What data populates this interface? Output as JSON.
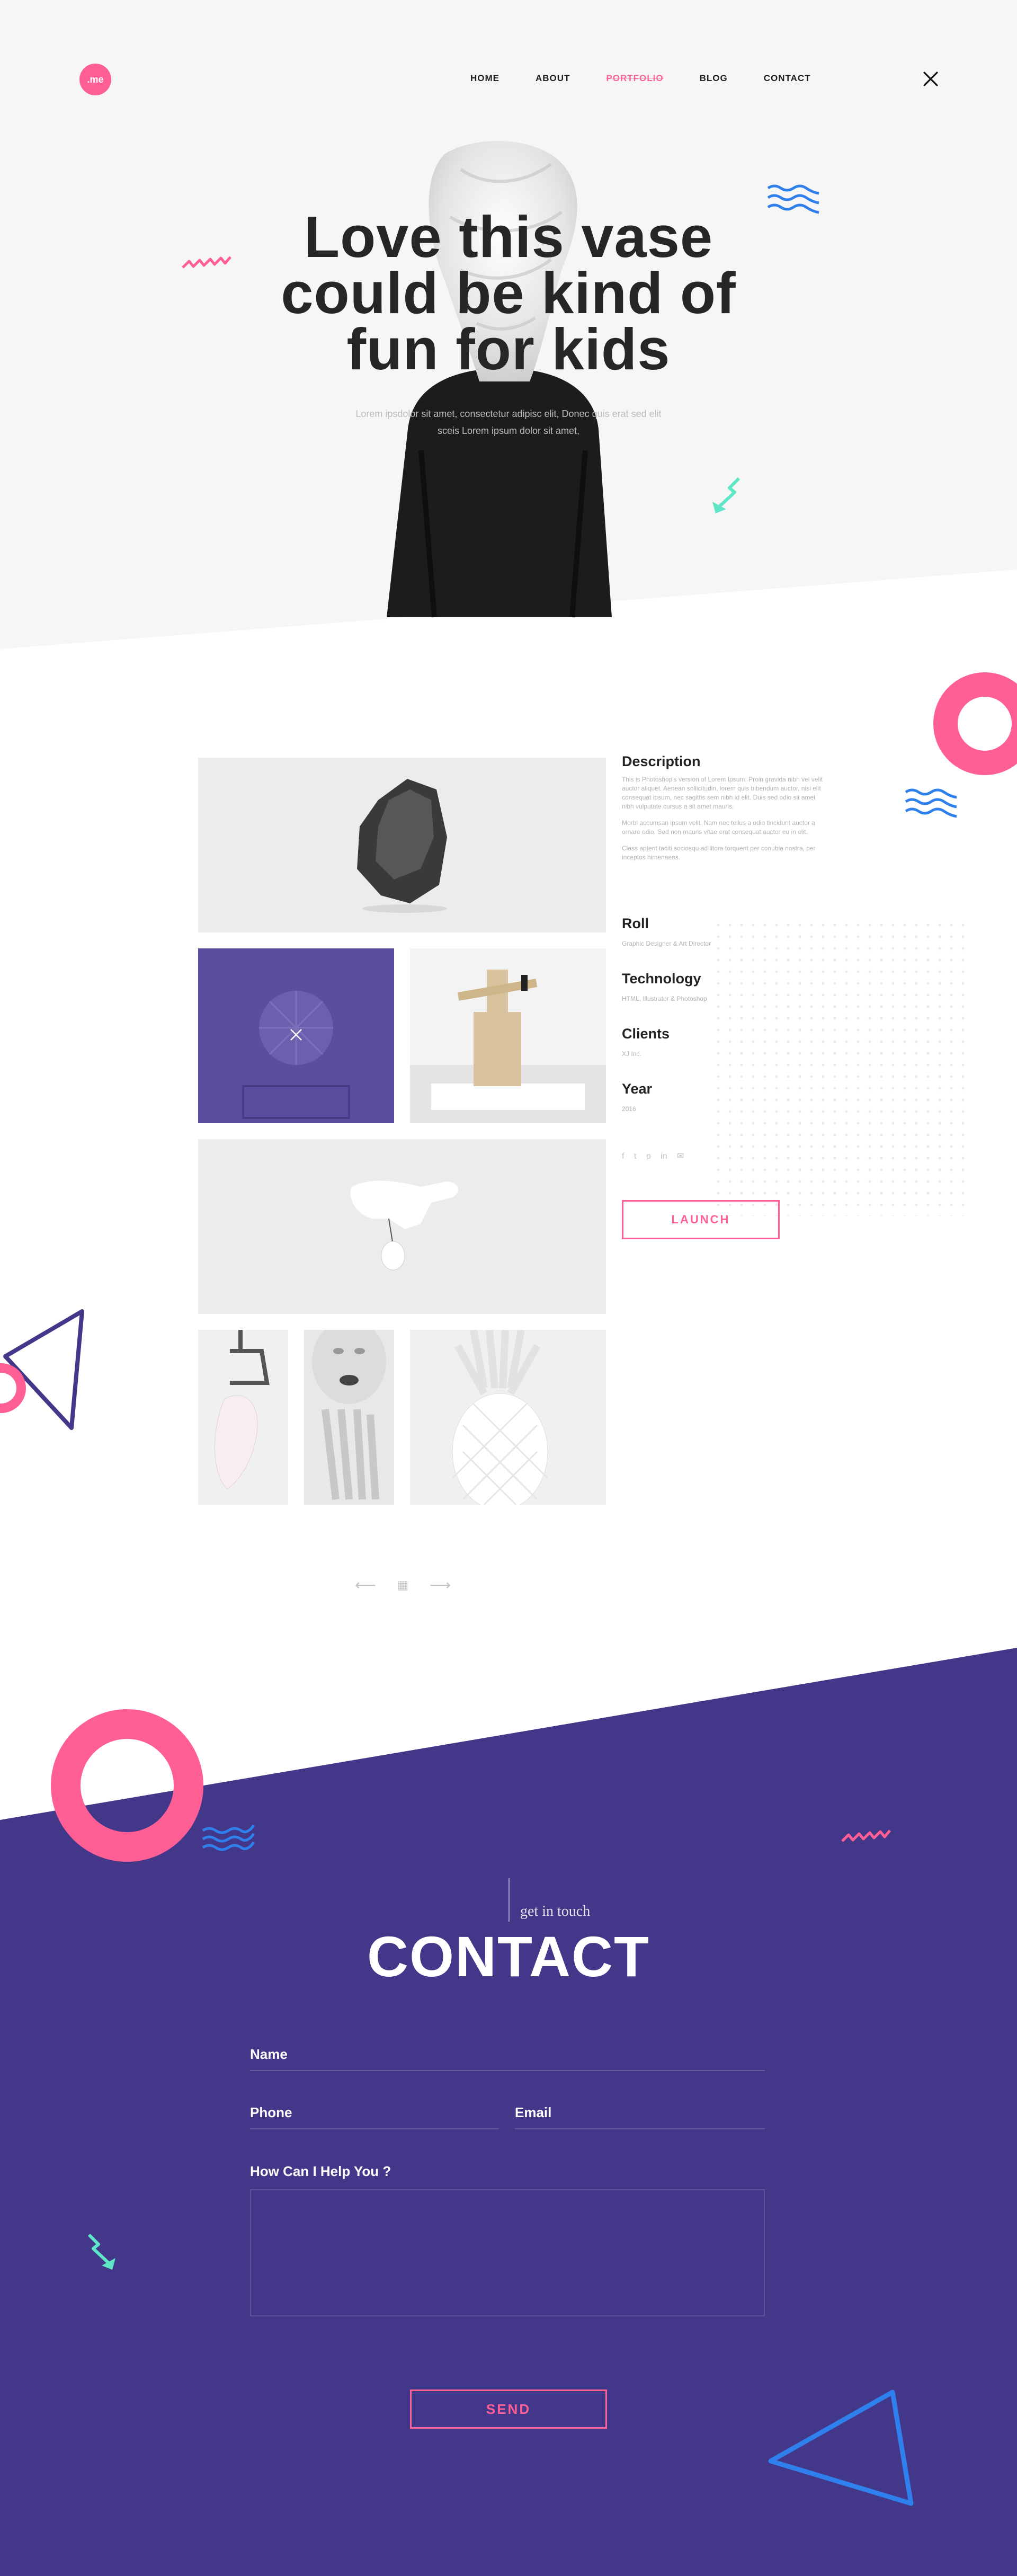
{
  "brand": {
    "logo_text": ".me",
    "accent": "#ff5f95",
    "purple": "#433789",
    "blue": "#2f80ed",
    "mint": "#5ee6c6"
  },
  "nav": {
    "items": [
      {
        "label": "HOME"
      },
      {
        "label": "ABOUT"
      },
      {
        "label": "PORTFOLIO",
        "active": true
      },
      {
        "label": "BLOG"
      },
      {
        "label": "CONTACT"
      }
    ],
    "close_icon": "close-icon"
  },
  "hero": {
    "title_lines": [
      "Love this vase",
      "could be kind of",
      "fun for kids"
    ],
    "subtitle_lines": [
      "Lorem ipsdolor sit amet, consectetur adipisc elit, Donec quis erat sed elit",
      "sceis Lorem ipsum dolor sit amet,"
    ]
  },
  "project": {
    "description_title": "Description",
    "description_paragraphs": [
      "This is Photoshop's version of Lorem Ipsum. Proin gravida nibh vel velit auctor aliquet. Aenean sollicitudin, lorem quis bibendum auctor, nisi elit consequat ipsum, nec sagittis sem nibh id elit. Duis sed odio sit amet nibh vulputate cursus a sit amet mauris.",
      "Morbi accumsan ipsum velit. Nam nec tellus a odio tincidunt auctor a ornare odio. Sed non mauris vitae erat consequat auctor eu in elit.",
      "Class aptent taciti sociosqu ad litora torquent per conubia nostra, per inceptos himenaeos."
    ],
    "meta": [
      {
        "title": "Roll",
        "value": "Graphic Designer & Art Director"
      },
      {
        "title": "Technology",
        "value": "HTML, Illustrator & Photoshop"
      },
      {
        "title": "Clients",
        "value": "XJ Inc."
      },
      {
        "title": "Year",
        "value": "2016"
      }
    ],
    "social_icons": [
      "f",
      "t",
      "p",
      "in",
      "✉"
    ],
    "launch_label": "LAUNCH"
  },
  "pager": {
    "prev": "⟵",
    "grid": "▦",
    "next": "⟶"
  },
  "contact": {
    "kicker": "get in touch",
    "title": "CONTACT",
    "fields": {
      "name_label": "Name",
      "phone_label": "Phone",
      "email_label": "Email",
      "message_label": "How Can I Help You ?"
    },
    "send_label": "SEND"
  }
}
